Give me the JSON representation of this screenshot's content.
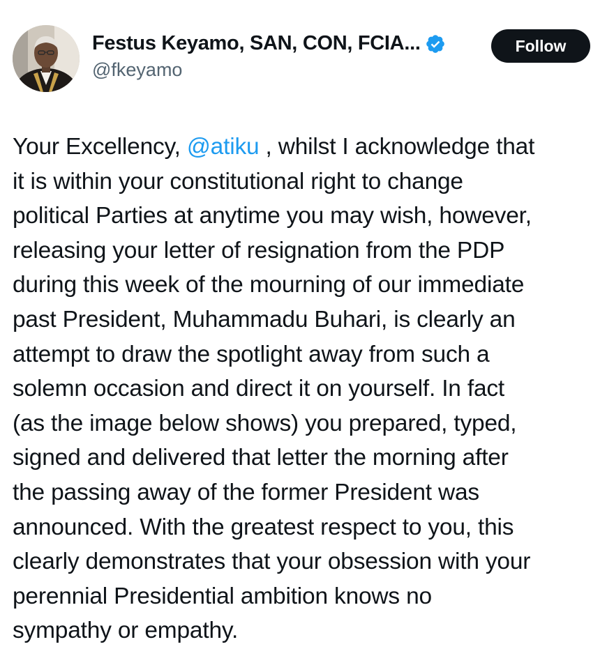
{
  "author": {
    "display_name": "Festus Keyamo, SAN, CON, FCIA...",
    "handle": "@fkeyamo",
    "verified_icon": "verified-badge-icon",
    "verified_color": "#1d9bf0"
  },
  "follow_button": {
    "label": "Follow"
  },
  "tweet": {
    "lines": [
      {
        "before": "Your Excellency, ",
        "mention": "@atiku",
        "after": " , whilst I acknowledge that"
      },
      "it is within your constitutional right to change",
      "political Parties at anytime you may wish, however,",
      "releasing your letter of resignation from the PDP",
      "during this week of the mourning of our immediate",
      "past President, Muhammadu Buhari, is clearly an",
      "attempt to draw the spotlight away from such a",
      "solemn occasion and direct it on yourself. In fact",
      "(as the image below shows) you prepared, typed,",
      "signed and delivered that letter the morning after",
      "the passing away of the former President was",
      "announced. With the greatest respect to you, this",
      "clearly demonstrates that your obsession with your",
      "perennial Presidential ambition knows no",
      "sympathy or empathy."
    ]
  },
  "colors": {
    "text": "#0f1419",
    "secondary_text": "#536471",
    "link": "#1d9bf0",
    "button_bg": "#0f1419",
    "button_text": "#ffffff"
  }
}
